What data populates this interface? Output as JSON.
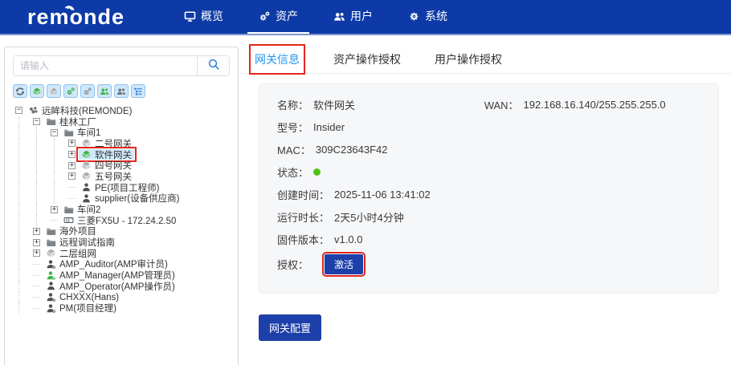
{
  "colors": {
    "navbar": "#0d3aa6",
    "accent_blue": "#2196f3",
    "button_blue": "#1d3fa9",
    "annotation_red": "#e3261f",
    "selected_row": "#cfe8fc",
    "green": "#3bb44a",
    "gray_icon": "#9aa0a6",
    "status_online": "#4cc414"
  },
  "navbar": {
    "logo": "remonde",
    "items": [
      {
        "name": "overview",
        "icon": "monitor-icon",
        "label": "概览",
        "active": false
      },
      {
        "name": "assets",
        "icon": "cogs-icon",
        "label": "资产",
        "active": true
      },
      {
        "name": "users",
        "icon": "users-icon",
        "label": "用户",
        "active": false
      },
      {
        "name": "system",
        "icon": "gear-icon",
        "label": "系统",
        "active": false
      }
    ]
  },
  "sidebar": {
    "search": {
      "placeholder": "请输入",
      "value": "",
      "icon": "search-icon"
    },
    "toolbar": [
      {
        "name": "refresh",
        "icon": "refresh-icon",
        "color": "#555c63"
      },
      {
        "name": "gateway-online",
        "icon": "cube-icon",
        "color": "#3bb44a"
      },
      {
        "name": "gateway-offline",
        "icon": "cube-icon",
        "color": "#a9aeb4"
      },
      {
        "name": "assets-online",
        "icon": "cogs-icon",
        "color": "#3bb44a"
      },
      {
        "name": "assets-offline",
        "icon": "cogs-icon",
        "color": "#8d9299"
      },
      {
        "name": "users-online",
        "icon": "users-icon",
        "color": "#3bb44a"
      },
      {
        "name": "users-offline",
        "icon": "users-icon",
        "color": "#6d7278"
      },
      {
        "name": "tree-view",
        "icon": "tree-list-icon",
        "color": "#2a7fd4"
      }
    ],
    "tree": [
      {
        "label": "远眸科技(REMONDE)",
        "level": 0,
        "expander": "minus",
        "icon": "org-icon"
      },
      {
        "label": "桂林工厂",
        "level": 1,
        "expander": "minus",
        "icon": "folder-icon"
      },
      {
        "label": "车间1",
        "level": 2,
        "expander": "minus",
        "icon": "folder-icon"
      },
      {
        "label": "二号网关",
        "level": 3,
        "expander": "plus",
        "icon": "cube-icon",
        "color": "#a9aeb4"
      },
      {
        "label": "软件网关",
        "level": 3,
        "expander": "plus",
        "icon": "cube-icon",
        "color": "#3bb44a",
        "selected": true,
        "annotated": true
      },
      {
        "label": "四号网关",
        "level": 3,
        "expander": "plus",
        "icon": "cube-icon",
        "color": "#a9aeb4"
      },
      {
        "label": "五号网关",
        "level": 3,
        "expander": "plus",
        "icon": "cube-icon",
        "color": "#a9aeb4"
      },
      {
        "label": "PE(项目工程师)",
        "level": 3,
        "expander": null,
        "icon": "person-icon",
        "color": "#4a4f54"
      },
      {
        "label": "supplier(设备供应商)",
        "level": 3,
        "expander": null,
        "icon": "person-icon",
        "color": "#4a4f54"
      },
      {
        "label": "车间2",
        "level": 2,
        "expander": "plus",
        "icon": "folder-icon"
      },
      {
        "label": "三菱FX5U - 172.24.2.50",
        "level": 2,
        "expander": null,
        "icon": "plc-icon"
      },
      {
        "label": "海外项目",
        "level": 1,
        "expander": "plus",
        "icon": "folder-icon"
      },
      {
        "label": "远程调试指南",
        "level": 1,
        "expander": "plus",
        "icon": "folder-icon"
      },
      {
        "label": "二层组网",
        "level": 1,
        "expander": "plus",
        "icon": "cube-icon",
        "color": "#a9aeb4"
      },
      {
        "label": "AMP_Auditor(AMP审计员)",
        "level": 1,
        "expander": null,
        "icon": "person-badge-icon",
        "color": "#4a4f54"
      },
      {
        "label": "AMP_Manager(AMP管理员)",
        "level": 1,
        "expander": null,
        "icon": "person-badge-icon",
        "color": "#3bb44a"
      },
      {
        "label": "AMP_Operator(AMP操作员)",
        "level": 1,
        "expander": null,
        "icon": "person-icon",
        "color": "#4a4f54"
      },
      {
        "label": "CHXXX(Hans)",
        "level": 1,
        "expander": null,
        "icon": "person-badge-icon",
        "color": "#4a4f54"
      },
      {
        "label": "PM(项目经理)",
        "level": 1,
        "expander": null,
        "icon": "person-badge-icon",
        "color": "#4a4f54"
      }
    ]
  },
  "main": {
    "tabs": [
      {
        "name": "gateway-info",
        "label": "网关信息",
        "active": true,
        "annotated": true
      },
      {
        "name": "asset-auth",
        "label": "资产操作授权",
        "active": false,
        "annotated": false
      },
      {
        "name": "user-op-auth",
        "label": "用户操作授权",
        "active": false,
        "annotated": false
      }
    ],
    "details": {
      "rows": [
        {
          "label": "名称",
          "value": "软件网关"
        },
        {
          "label": "型号",
          "value": "Insider"
        },
        {
          "label": "MAC",
          "value": "309C23643F42"
        },
        {
          "label": "状态",
          "type": "dot",
          "value": ""
        },
        {
          "label": "创建时间",
          "value": "2025-11-06 13:41:02"
        },
        {
          "label": "运行时长",
          "value": "2天5小时4分钟"
        },
        {
          "label": "固件版本",
          "value": "v1.0.0"
        },
        {
          "label": "授权",
          "type": "button",
          "value": "激活",
          "annotated": true
        }
      ],
      "wan": {
        "label": "WAN",
        "value": "192.168.16.140/255.255.255.0"
      }
    },
    "configure_button": "网关配置"
  }
}
